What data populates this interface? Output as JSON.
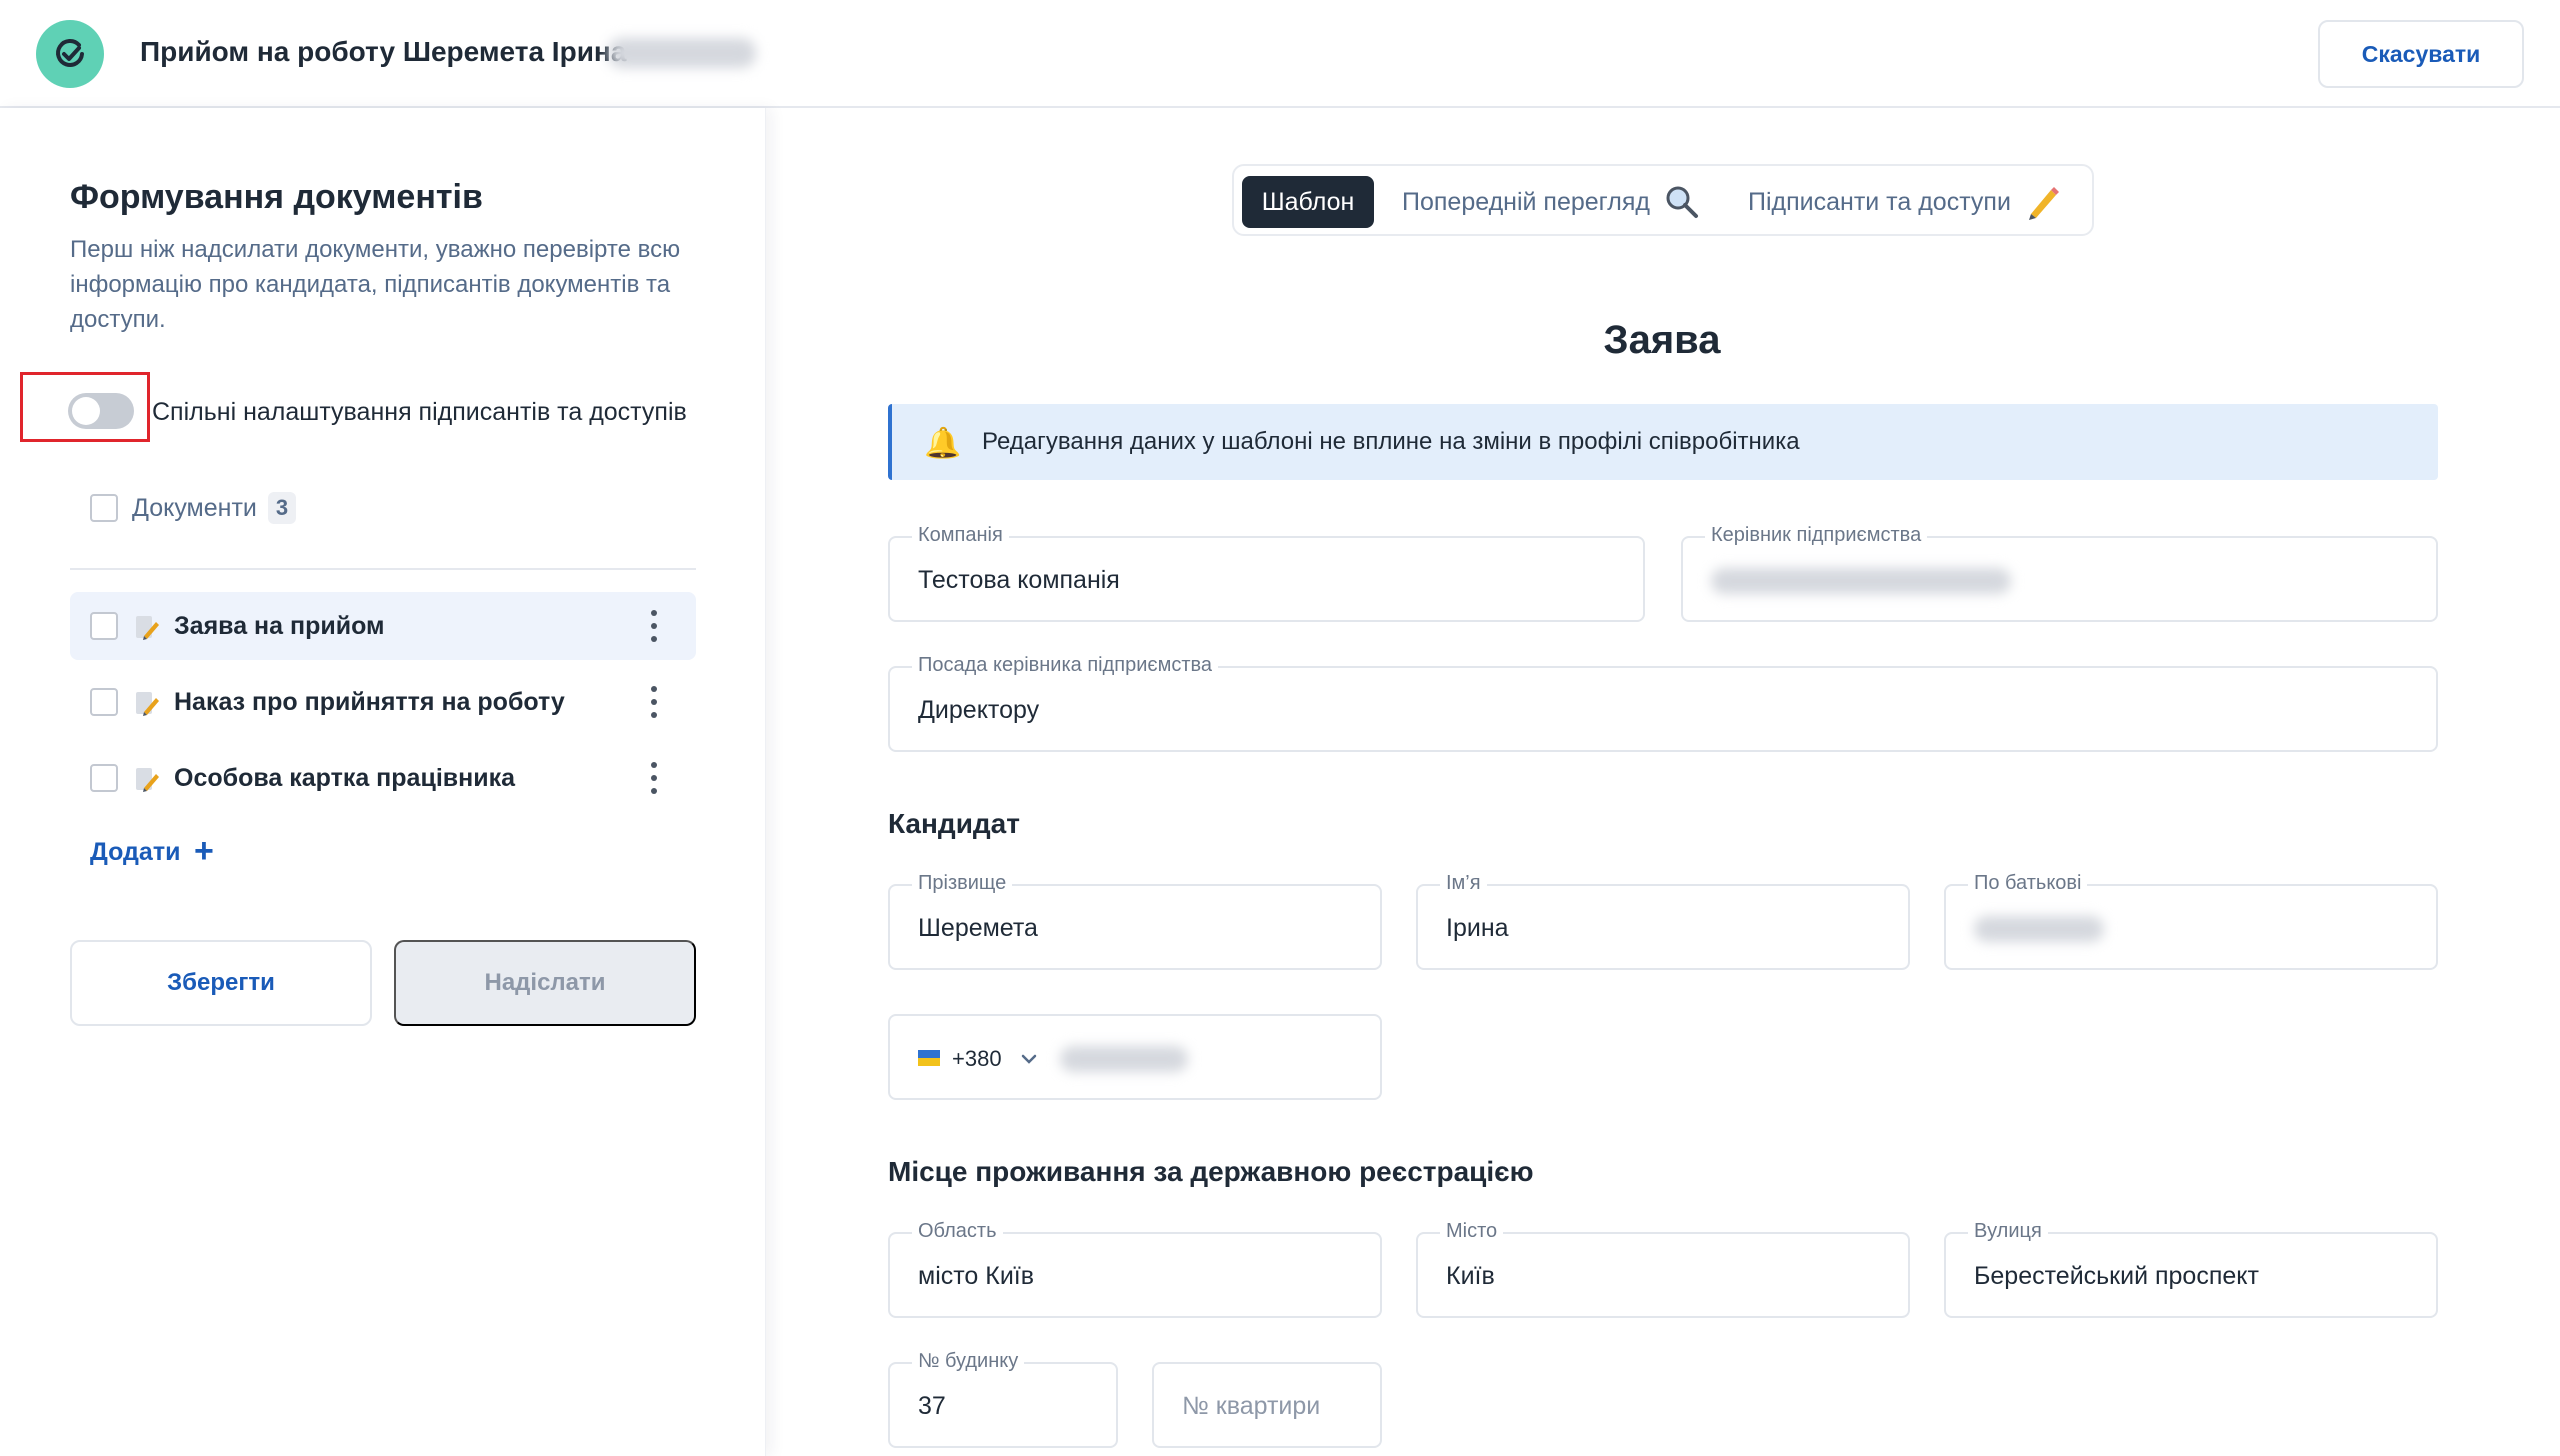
{
  "header": {
    "title": "Прийом на роботу Шеремета Ірина",
    "cancel_label": "Скасувати"
  },
  "left": {
    "title": "Формування документів",
    "description": "Перш ніж надсилати документи, уважно перевірте всю інформацію про кандидата, підписантів документів та доступи.",
    "toggle_label": "Спільні налаштування підписантів та доступів",
    "toggle_on": false,
    "documents_label": "Документи",
    "documents_count": "3",
    "documents": [
      {
        "label": "Заява на прийом"
      },
      {
        "label": "Наказ про прийняття на роботу"
      },
      {
        "label": "Особова картка працівника"
      }
    ],
    "add_label": "Додати",
    "save_label": "Зберегти",
    "send_label": "Надіслати"
  },
  "tabs": {
    "template": "Шаблон",
    "preview": "Попередній перегляд",
    "signers": "Підписанти та доступи",
    "active": "Шаблон"
  },
  "form": {
    "title": "Заява",
    "banner": "Редагування даних у шаблоні не вплине на зміни в профілі співробітника",
    "company_label": "Компанія",
    "company_value": "Тестова компанія",
    "director_label": "Керівник підприємства",
    "director_position_label": "Посада керівника підприємства",
    "director_position_value": "Директору",
    "candidate_title": "Кандидат",
    "surname_label": "Прізвище",
    "surname_value": "Шеремета",
    "name_label": "Ім’я",
    "name_value": "Ірина",
    "patronymic_label": "По батькові",
    "phone_code": "+380",
    "address_title": "Місце проживання за державною реєстрацією",
    "region_label": "Область",
    "region_value": "місто Київ",
    "city_label": "Місто",
    "city_value": "Київ",
    "street_label": "Вулиця",
    "street_value": "Берестейський проспект",
    "house_label": "№ будинку",
    "house_value": "37",
    "apartment_placeholder": "№ квартири"
  },
  "colors": {
    "accent": "#1a5bb8",
    "logo": "#5fd1b5",
    "dark": "#1f2a37",
    "banner_bg": "#e3eefb",
    "highlight_red": "#e0252c"
  }
}
